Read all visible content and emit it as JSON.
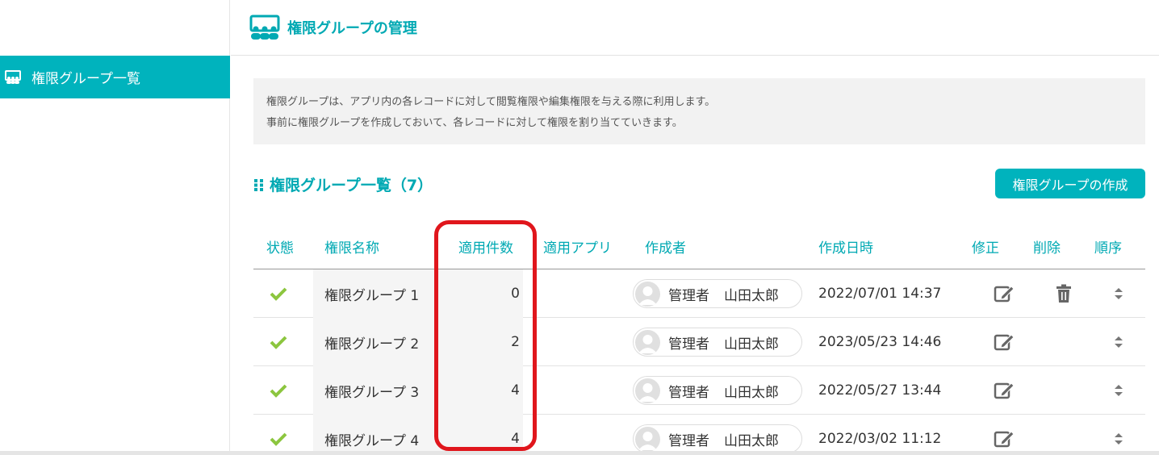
{
  "header": {
    "title": "権限グループの管理"
  },
  "sidebar": {
    "items": [
      {
        "label": "権限グループ一覧",
        "active": true
      }
    ]
  },
  "notice": {
    "line1": "権限グループは、アプリ内の各レコードに対して閲覧権限や編集権限を与える際に利用します。",
    "line2": "事前に権限グループを作成しておいて、各レコードに対して権限を割り当てていきます。"
  },
  "list": {
    "title": "権限グループ一覧（7）",
    "create_button": "権限グループの作成",
    "columns": {
      "status": "状態",
      "name": "権限名称",
      "count": "適用件数",
      "app": "適用アプリ",
      "creator": "作成者",
      "created_at": "作成日時",
      "edit": "修正",
      "delete": "削除",
      "order": "順序"
    },
    "rows": [
      {
        "name": "権限グループ 1",
        "count": "0",
        "creator_role": "管理者",
        "creator_name": "山田太郎",
        "created_at": "2022/07/01 14:37",
        "deletable": true
      },
      {
        "name": "権限グループ 2",
        "count": "2",
        "creator_role": "管理者",
        "creator_name": "山田太郎",
        "created_at": "2023/05/23 14:46",
        "deletable": false
      },
      {
        "name": "権限グループ 3",
        "count": "4",
        "creator_role": "管理者",
        "creator_name": "山田太郎",
        "created_at": "2022/05/27 13:44",
        "deletable": false
      },
      {
        "name": "権限グループ 4",
        "count": "4",
        "creator_role": "管理者",
        "creator_name": "山田太郎",
        "created_at": "2022/03/02 11:12",
        "deletable": false
      }
    ]
  },
  "colors": {
    "accent": "#00b3bd",
    "check": "#8cc63f",
    "highlight": "#e0161c"
  },
  "icons": {
    "header": "group-icon",
    "sidebar": "group-icon",
    "section": "grid-dots-icon",
    "status": "check-icon",
    "edit": "edit-icon",
    "delete": "trash-icon",
    "order": "sort-icon",
    "avatar": "user-avatar-icon"
  }
}
